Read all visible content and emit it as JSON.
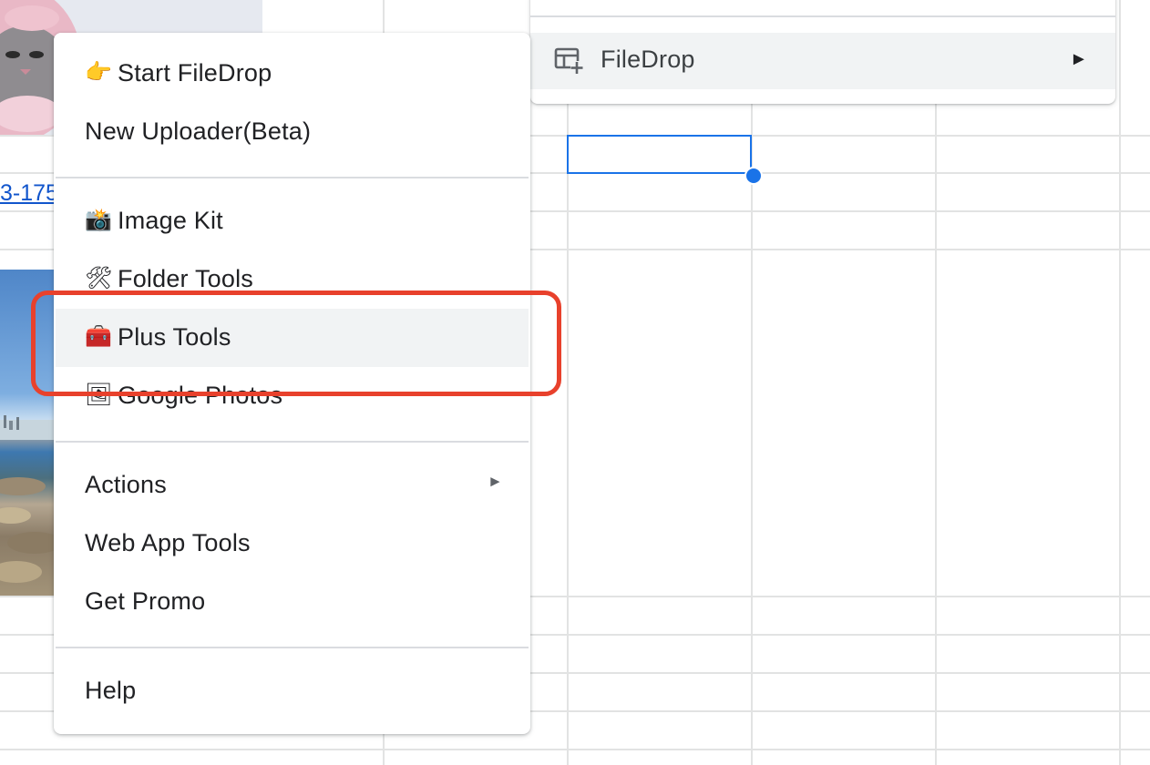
{
  "sheet": {
    "cell_link_text": "3-175",
    "grid_color": "#e2e3e3",
    "selection_color": "#1a73e8"
  },
  "parent_menu": {
    "item": {
      "icon": "table-add-icon",
      "label": "FileDrop",
      "arrow": "►",
      "state": "hovered"
    }
  },
  "submenu": {
    "items": [
      {
        "emoji": "👉",
        "icon": "pointing-hand-icon",
        "label": "Start FileDrop"
      },
      {
        "label": "New Uploader(Beta)"
      },
      {
        "emoji": "📸",
        "icon": "camera-flash-icon",
        "label": "Image Kit"
      },
      {
        "emoji": "🛠",
        "icon": "tools-icon",
        "label": "Folder Tools"
      },
      {
        "emoji": "🧰",
        "icon": "toolbox-icon",
        "label": "Plus Tools",
        "state": "hovered"
      },
      {
        "emoji": "🖼",
        "icon": "framed-picture-icon",
        "label": "Google Photos"
      },
      {
        "label": "Actions",
        "arrow": "►"
      },
      {
        "label": "Web App Tools"
      },
      {
        "label": "Get Promo"
      },
      {
        "label": "Help"
      }
    ]
  },
  "annotation": {
    "highlight_color": "#e8412c",
    "target": "Plus Tools"
  }
}
